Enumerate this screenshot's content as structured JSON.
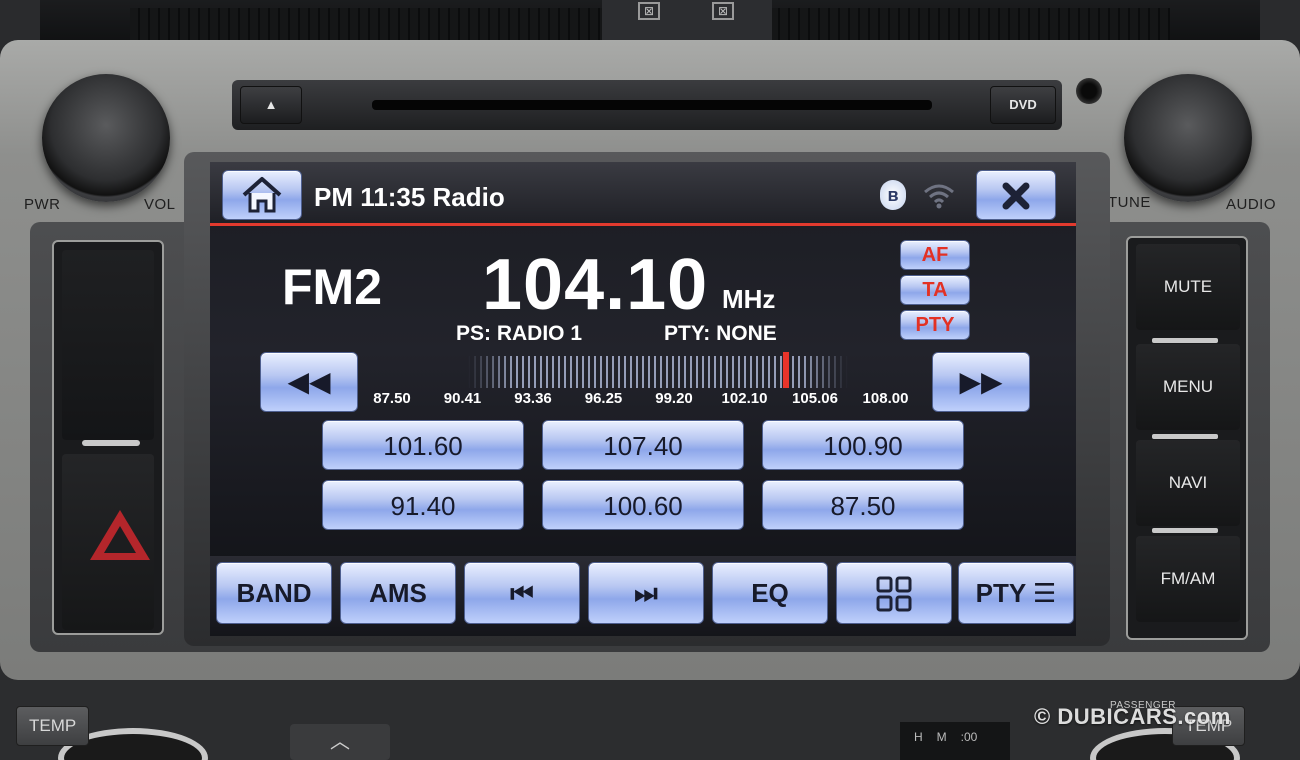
{
  "hardware": {
    "pwr_label": "PWR",
    "vol_label": "VOL",
    "tune_label": "TUNE",
    "audio_label": "AUDIO",
    "eject_label": "▲",
    "dvd_label": "DVD",
    "side_buttons": [
      "MUTE",
      "MENU",
      "NAVI",
      "FM/AM"
    ],
    "temp_left": "TEMP",
    "temp_right": "TEMP",
    "passenger": "PASSENGER",
    "clock_h": "H",
    "clock_m": "M",
    "clock_00": ":00",
    "up_arrow": "︿"
  },
  "status": {
    "title": "PM 11:35 Radio",
    "bt_symbol": "ʙ"
  },
  "radio": {
    "band": "FM2",
    "frequency": "104.10",
    "unit": "MHz",
    "ps": "PS: RADIO 1",
    "pty": "PTY:  NONE",
    "tags": [
      "AF",
      "TA",
      "PTY"
    ],
    "tuner_position": 0.83,
    "scale_labels": [
      "87.50",
      "90.41",
      "93.36",
      "96.25",
      "99.20",
      "102.10",
      "105.06",
      "108.00"
    ]
  },
  "presets": [
    "101.60",
    "107.40",
    "100.90",
    "91.40",
    "100.60",
    "87.50"
  ],
  "functions": [
    "BAND",
    "AMS",
    "⏮",
    "⏭",
    "EQ",
    "",
    "PTY"
  ],
  "watermark": "© DUBICARS.com",
  "colors": {
    "accent_red": "#e23a2e",
    "button_blue": "#b9c8f2"
  }
}
